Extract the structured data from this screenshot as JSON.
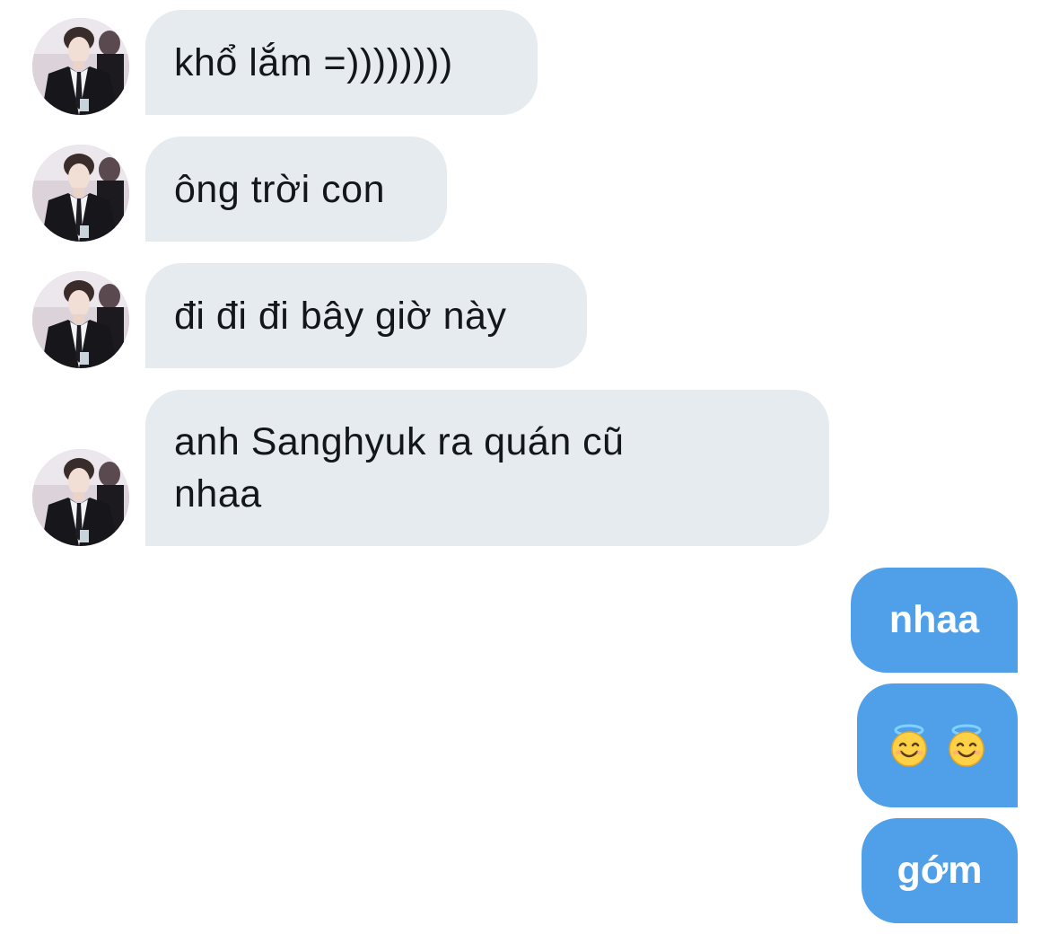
{
  "conversation": {
    "incoming": [
      {
        "text": "khổ lắm =))))))))"
      },
      {
        "text": "ông trời con"
      },
      {
        "text": "đi đi đi bây giờ này"
      },
      {
        "text": "anh Sanghyuk ra quán cũ nhaa"
      }
    ],
    "outgoing": [
      {
        "text": "nhaa"
      },
      {
        "emojis": [
          "smiling-face-with-halo",
          "smiling-face-with-halo"
        ]
      },
      {
        "text": "gớm"
      }
    ],
    "colors": {
      "incoming_bubble": "#e6ebef",
      "outgoing_bubble": "#4fa0e8",
      "incoming_text": "#14171a",
      "outgoing_text": "#ffffff"
    }
  }
}
